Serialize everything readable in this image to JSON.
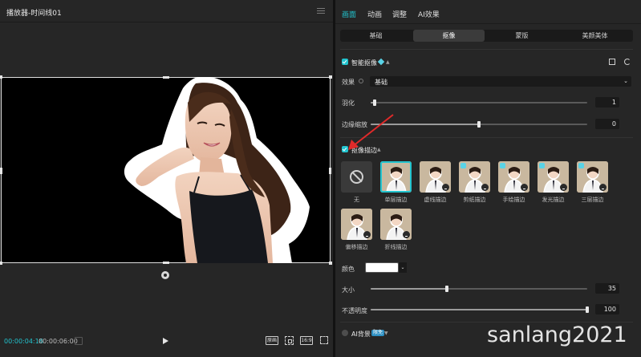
{
  "player": {
    "title": "播放器-时间线01",
    "current_time": "00:00:04:18",
    "total_time": "00:00:06:00",
    "btn_quality": "原画",
    "btn_ratio": "16:9"
  },
  "panel": {
    "tabs": [
      "画面",
      "动画",
      "调整",
      "AI效果"
    ],
    "active_tab": "画面",
    "sub_tabs": [
      "基础",
      "抠像",
      "蒙版",
      "美颜美体"
    ],
    "active_sub_tab": "抠像",
    "smart_cutout": {
      "label": "智能抠像",
      "enabled": true,
      "effect_label": "效果",
      "effect_value": "基础",
      "feather_label": "羽化",
      "feather_value": "1",
      "feather_level": 0.02,
      "edge_label": "边缘缩放",
      "edge_value": "0",
      "edge_level": 0.5
    },
    "cutout_stroke": {
      "label": "抠像描边",
      "enabled": true,
      "styles": [
        {
          "name": "无",
          "selected": false,
          "none": true
        },
        {
          "name": "单层描边",
          "selected": true
        },
        {
          "name": "虚线描边",
          "selected": false,
          "download": true
        },
        {
          "name": "剪纸描边",
          "selected": false,
          "download": true,
          "vip": true
        },
        {
          "name": "手绘描边",
          "selected": false,
          "download": true,
          "vip": true
        },
        {
          "name": "发光描边",
          "selected": false,
          "download": true,
          "vip": true
        },
        {
          "name": "三层描边",
          "selected": false,
          "download": true,
          "vip": true
        },
        {
          "name": "偏移描边",
          "selected": false,
          "download": true
        },
        {
          "name": "折线描边",
          "selected": false,
          "download": true
        }
      ],
      "color_label": "颜色",
      "color_value": "#ffffff",
      "size_label": "大小",
      "size_value": "35",
      "size_level": 0.35,
      "opacity_label": "不透明度",
      "opacity_value": "100",
      "opacity_level": 1.0
    },
    "ai_background": {
      "label": "AI背景",
      "badge": "限免",
      "enabled": false
    }
  },
  "colors": {
    "accent": "#22c4cf",
    "panel_bg": "#262626",
    "arrow": "#e02a2a"
  },
  "watermark": "sanlang2021"
}
